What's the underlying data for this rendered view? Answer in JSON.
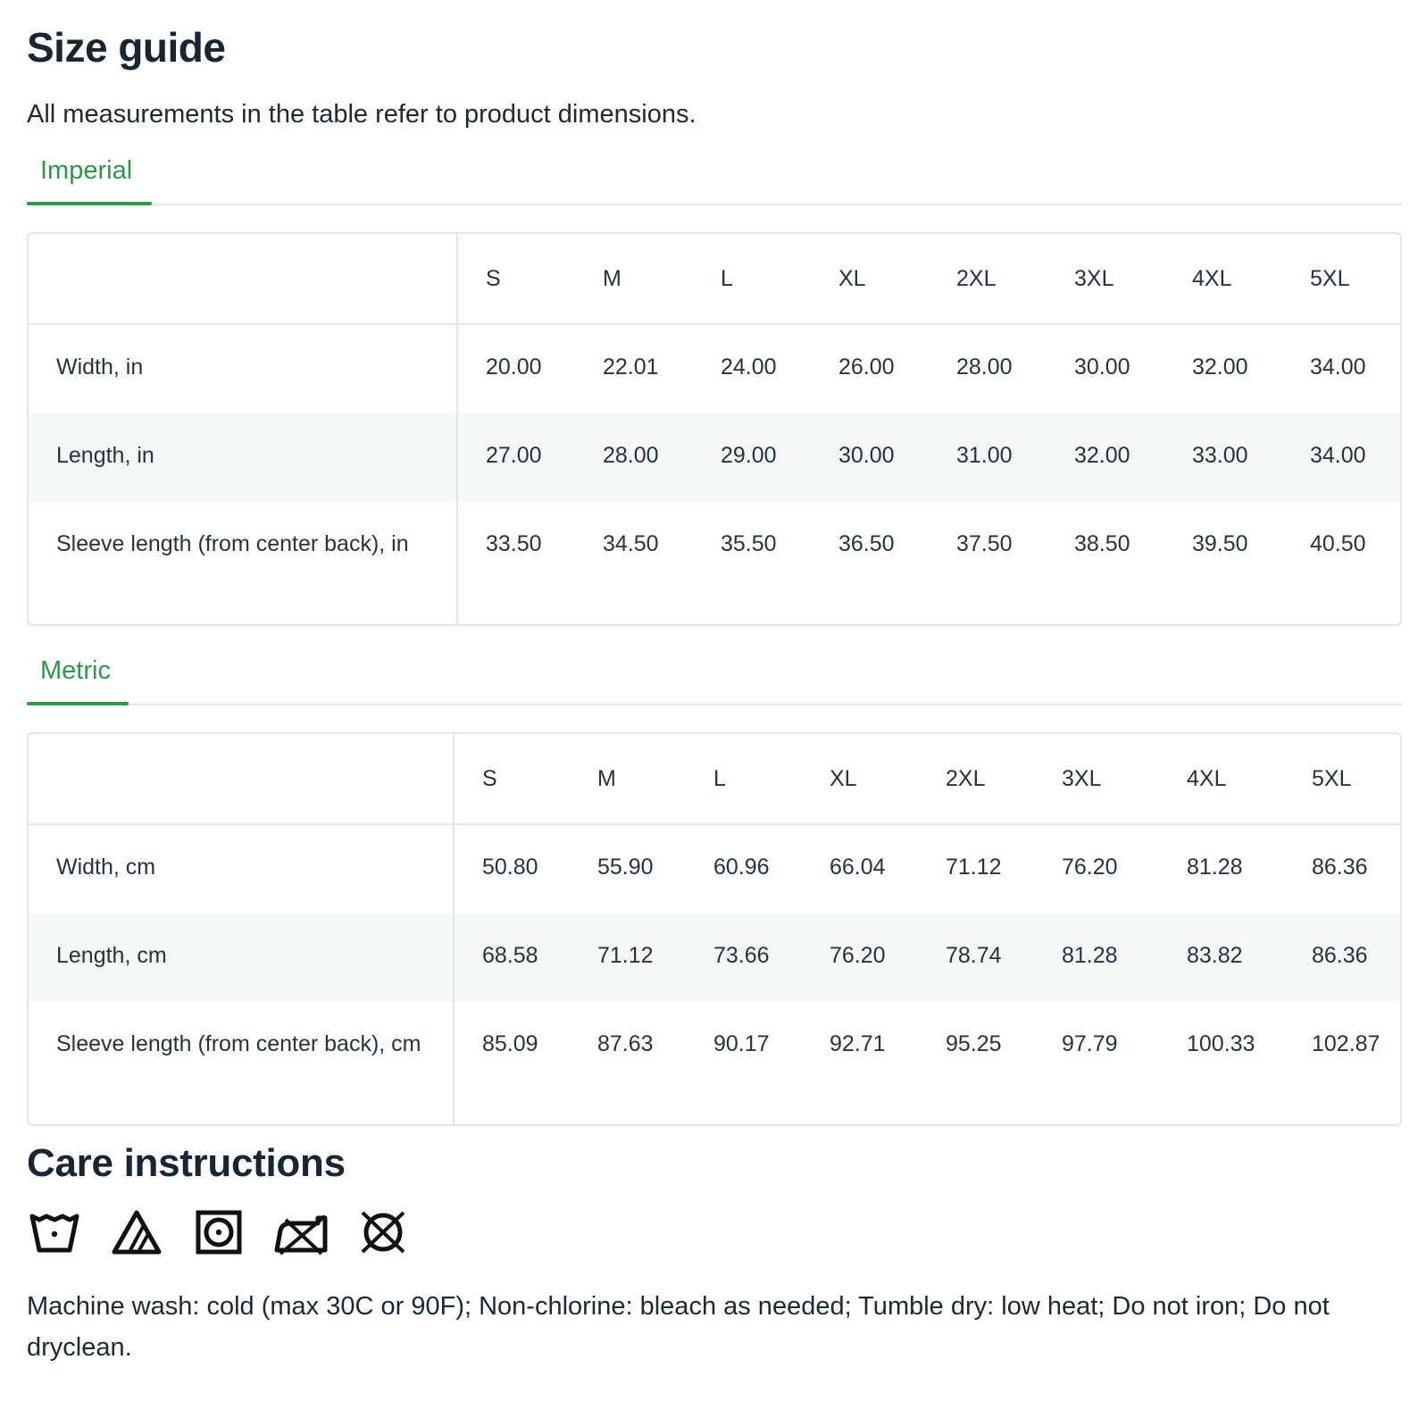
{
  "title": "Size guide",
  "subtitle": "All measurements in the table refer to product dimensions.",
  "tabs": {
    "imperial": "Imperial",
    "metric": "Metric"
  },
  "sizes": [
    "S",
    "M",
    "L",
    "XL",
    "2XL",
    "3XL",
    "4XL",
    "5XL"
  ],
  "imperial": {
    "rows": [
      {
        "label": "Width, in",
        "values": [
          "20.00",
          "22.01",
          "24.00",
          "26.00",
          "28.00",
          "30.00",
          "32.00",
          "34.00"
        ]
      },
      {
        "label": "Length, in",
        "values": [
          "27.00",
          "28.00",
          "29.00",
          "30.00",
          "31.00",
          "32.00",
          "33.00",
          "34.00"
        ]
      },
      {
        "label": "Sleeve length (from center back), in",
        "values": [
          "33.50",
          "34.50",
          "35.50",
          "36.50",
          "37.50",
          "38.50",
          "39.50",
          "40.50"
        ]
      }
    ]
  },
  "metric": {
    "rows": [
      {
        "label": "Width, cm",
        "values": [
          "50.80",
          "55.90",
          "60.96",
          "66.04",
          "71.12",
          "76.20",
          "81.28",
          "86.36"
        ]
      },
      {
        "label": "Length, cm",
        "values": [
          "68.58",
          "71.12",
          "73.66",
          "76.20",
          "78.74",
          "81.28",
          "83.82",
          "86.36"
        ]
      },
      {
        "label": "Sleeve length (from center back), cm",
        "values": [
          "85.09",
          "87.63",
          "90.17",
          "92.71",
          "95.25",
          "97.79",
          "100.33",
          "102.87"
        ]
      }
    ]
  },
  "care": {
    "title": "Care instructions",
    "icons": [
      "machine-wash-cold-icon",
      "non-chlorine-bleach-icon",
      "tumble-dry-low-icon",
      "do-not-iron-icon",
      "do-not-dryclean-icon"
    ],
    "text": "Machine wash: cold (max 30C or 90F); Non-chlorine: bleach as needed; Tumble dry: low heat; Do not iron; Do not dryclean."
  },
  "colors": {
    "accent": "#2a9a4a",
    "text": "#1c2a33",
    "border": "#e3e6e8",
    "stripe": "#f6f7f7"
  }
}
